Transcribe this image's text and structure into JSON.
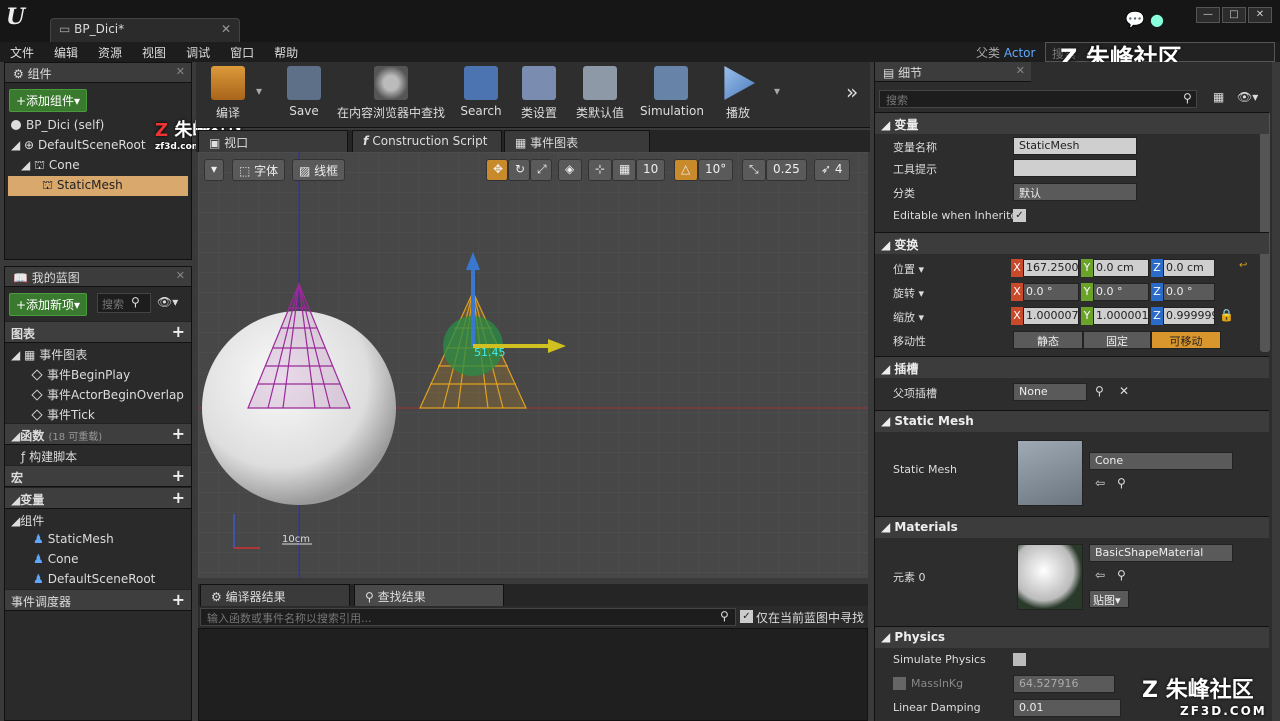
{
  "title_tab": "BP_Dici*",
  "menu": [
    "文件",
    "编辑",
    "资源",
    "视图",
    "调试",
    "窗口",
    "帮助"
  ],
  "parent_class": {
    "label": "父类",
    "value": "Actor"
  },
  "top_search_placeholder": "搜索",
  "watermark": {
    "cn": "朱峰社区",
    "en": "ZF3D.COM",
    "small": "zf3d.com"
  },
  "components": {
    "tab": "组件",
    "add_button": "+添加组件▾",
    "self_label": "BP_Dici (self)",
    "tree": [
      "DefaultSceneRoot",
      "Cone",
      "StaticMesh"
    ]
  },
  "my_blueprint": {
    "tab": "我的蓝图",
    "add_new": "+添加新项▾",
    "search_placeholder": "搜索",
    "graphs": "图表",
    "event_graph": "事件图表",
    "events": [
      "事件BeginPlay",
      "事件ActorBeginOverlap",
      "事件Tick"
    ],
    "functions": "函数",
    "functions_note": "(18 可重载)",
    "construct": "构建脚本",
    "macros": "宏",
    "variables": "变量",
    "components": "组件",
    "var_components": [
      "StaticMesh",
      "Cone",
      "DefaultSceneRoot"
    ],
    "dispatchers": "事件调度器"
  },
  "toolbar": [
    {
      "label": "编译"
    },
    {
      "label": "Save"
    },
    {
      "label": "在内容浏览器中查找"
    },
    {
      "label": "Search"
    },
    {
      "label": "类设置"
    },
    {
      "label": "类默认值"
    },
    {
      "label": "Simulation"
    },
    {
      "label": "播放"
    }
  ],
  "graph_tabs": [
    "视口",
    "Construction Script",
    "事件图表"
  ],
  "viewport": {
    "view_btn": "字体",
    "lit_btn": "线框",
    "snap_grid": "10",
    "snap_rot": "10°",
    "snap_scale": "0.25",
    "cam_speed": "4",
    "gizmo_value": "51.45",
    "scale_bar": "10cm"
  },
  "bottom": {
    "tabs": [
      "编译器结果",
      "查找结果"
    ],
    "find_placeholder": "输入函数或事件名称以搜索引用...",
    "current_only": "仅在当前蓝图中寻找"
  },
  "details": {
    "tab": "细节",
    "search_placeholder": "搜索",
    "variable_section": "变量",
    "var_name_label": "变量名称",
    "var_name": "StaticMesh",
    "tooltip_label": "工具提示",
    "tooltip": "",
    "category_label": "分类",
    "category": "默认",
    "editable_label": "Editable when Inherited",
    "transform_section": "变换",
    "location_label": "位置 ▾",
    "location": [
      "167.2500",
      "0.0 cm",
      "0.0 cm"
    ],
    "rotation_label": "旋转 ▾",
    "rotation": [
      "0.0 °",
      "0.0 °",
      "0.0 °"
    ],
    "scale_label": "缩放 ▾",
    "scale": [
      "1.000007",
      "1.000001",
      "0.999999"
    ],
    "mobility_label": "移动性",
    "mobility": [
      "静态",
      "固定",
      "可移动"
    ],
    "sockets_section": "插槽",
    "parent_socket_label": "父项插槽",
    "parent_socket": "None",
    "static_mesh_section": "Static Mesh",
    "static_mesh_label": "Static Mesh",
    "static_mesh": "Cone",
    "materials_section": "Materials",
    "element_label": "元素 0",
    "material": "BasicShapeMaterial",
    "texture_btn": "贴图▾",
    "physics_section": "Physics",
    "simulate_label": "Simulate Physics",
    "mass_label": "MassInKg",
    "mass": "64.527916",
    "damping_label": "Linear Damping",
    "damping": "0.01"
  }
}
